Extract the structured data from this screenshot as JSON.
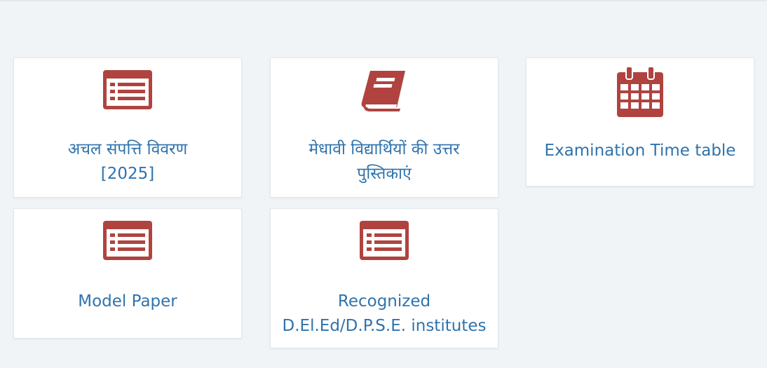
{
  "colors": {
    "page_background": "#f1f4f7",
    "card_background": "#ffffff",
    "icon_color": "#b0433f",
    "link_text": "#2f73ad"
  },
  "cards": [
    {
      "icon": "list-alt-icon",
      "lines": [
        "अचल संपत्ति विवरण",
        "[2025]"
      ]
    },
    {
      "icon": "book-icon",
      "lines": [
        "मेधावी विद्यार्थियों की उत्तर",
        "पुस्तिकाएं"
      ]
    },
    {
      "icon": "calendar-icon",
      "lines": [
        "Examination Time table"
      ]
    },
    {
      "icon": "list-alt-icon",
      "lines": [
        "Model Paper"
      ]
    },
    {
      "icon": "list-alt-icon",
      "lines": [
        "Recognized",
        "D.El.Ed/D.P.S.E. institutes"
      ]
    }
  ]
}
